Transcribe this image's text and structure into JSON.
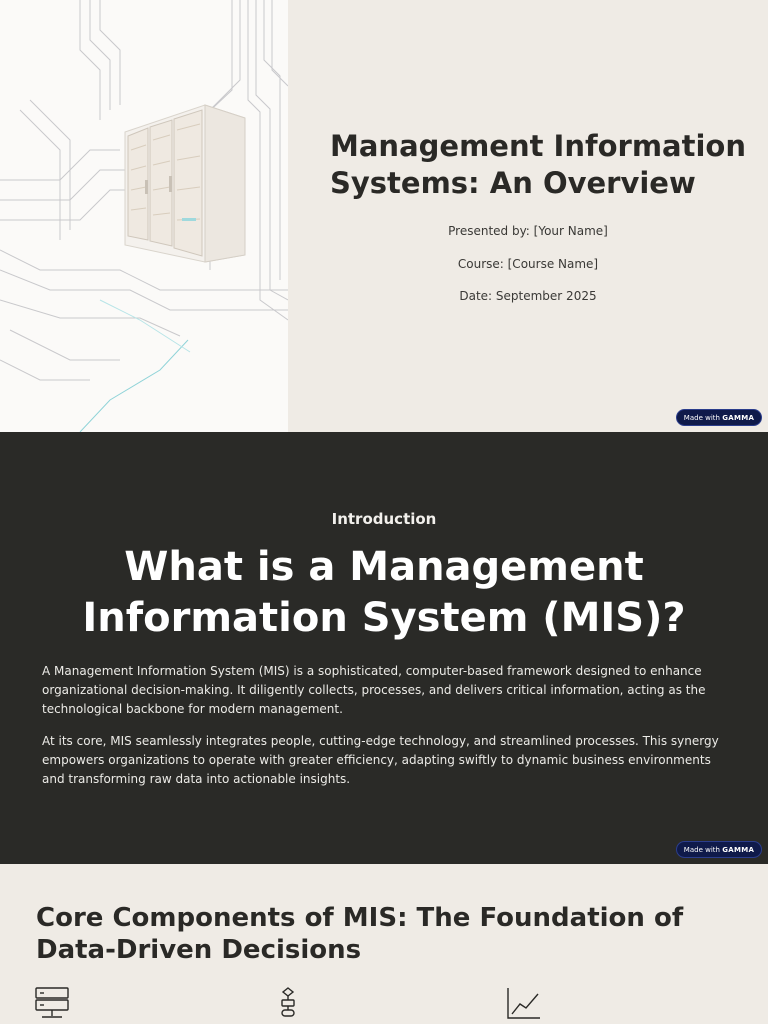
{
  "slide1": {
    "title": "Management Information Systems: An Overview",
    "presented_by": "Presented by: [Your Name]",
    "course": "Course: [Course Name]",
    "date": "Date: September 2025",
    "hero_image": "server-rack-circuit-illustration"
  },
  "badge": {
    "prefix": "Made with",
    "brand": "GAMMA"
  },
  "slide2": {
    "eyebrow": "Introduction",
    "title": "What is a Management Information System (MIS)?",
    "paragraph1": "A Management Information System (MIS) is a sophisticated, computer-based framework designed to enhance organizational decision-making. It diligently collects, processes, and delivers critical information, acting as the technological backbone for modern management.",
    "paragraph2": "At its core, MIS seamlessly integrates people, cutting-edge technology, and streamlined processes. This synergy empowers organizations to operate with greater efficiency, adapting swiftly to dynamic business environments and transforming raw data into actionable insights."
  },
  "slide3": {
    "title": "Core Components of MIS: The Foundation of Data-Driven Decisions",
    "icons": [
      "server-icon",
      "flowchart-icon",
      "line-chart-icon"
    ]
  },
  "colors": {
    "light_bg": "#efebe5",
    "dark_bg": "#2a2a27",
    "text_dark": "#2a2926",
    "badge_bg": "#0f1a4a"
  }
}
